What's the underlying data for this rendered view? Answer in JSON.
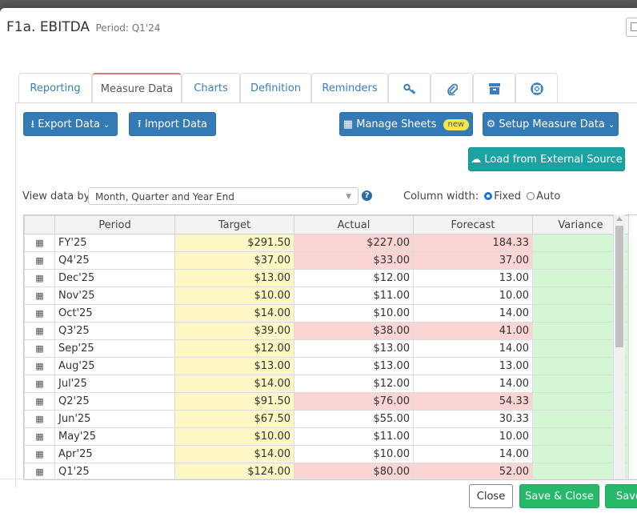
{
  "modal": {
    "title": "F1a. EBITDA",
    "period_label": "Period: Q1'24"
  },
  "tabs": [
    {
      "label": "Reporting",
      "active": false
    },
    {
      "label": "Measure Data",
      "active": true
    },
    {
      "label": "Charts",
      "active": false
    },
    {
      "label": "Definition",
      "active": false
    },
    {
      "label": "Reminders",
      "active": false
    },
    {
      "icon": "key-icon"
    },
    {
      "icon": "paperclip-icon"
    },
    {
      "icon": "archive-icon"
    },
    {
      "icon": "lifebuoy-icon"
    }
  ],
  "toolbar": {
    "export_label": "Export Data",
    "import_label": "Import Data",
    "manage_sheets_label": "Manage Sheets",
    "new_badge": "new",
    "setup_label": "Setup Measure Data",
    "load_external_label": "Load from External Source"
  },
  "view": {
    "view_by_label": "View data by:",
    "view_by_value": "Month, Quarter and Year End",
    "column_width_label": "Column width:",
    "fixed_label": "Fixed",
    "auto_label": "Auto",
    "selected_width": "Fixed"
  },
  "grid": {
    "columns": [
      "Period",
      "Target",
      "Actual",
      "Forecast",
      "Variance"
    ],
    "rows": [
      {
        "period": "FY'25",
        "target": "$291.50",
        "actual": "$227.00",
        "forecast": "184.33",
        "t": "yellow",
        "a": "red",
        "f": "red",
        "v": "green"
      },
      {
        "period": "Q4'25",
        "target": "$37.00",
        "actual": "$33.00",
        "forecast": "37.00",
        "t": "yellow",
        "a": "red",
        "f": "red",
        "v": "green"
      },
      {
        "period": "Dec'25",
        "target": "$13.00",
        "actual": "$12.00",
        "forecast": "13.00",
        "t": "yellow",
        "a": "white",
        "f": "white",
        "v": "green"
      },
      {
        "period": "Nov'25",
        "target": "$10.00",
        "actual": "$11.00",
        "forecast": "10.00",
        "t": "yellow",
        "a": "white",
        "f": "white",
        "v": "green"
      },
      {
        "period": "Oct'25",
        "target": "$14.00",
        "actual": "$10.00",
        "forecast": "14.00",
        "t": "yellow",
        "a": "white",
        "f": "white",
        "v": "green"
      },
      {
        "period": "Q3'25",
        "target": "$39.00",
        "actual": "$38.00",
        "forecast": "41.00",
        "t": "yellow",
        "a": "red",
        "f": "red",
        "v": "green"
      },
      {
        "period": "Sep'25",
        "target": "$12.00",
        "actual": "$13.00",
        "forecast": "14.00",
        "t": "yellow",
        "a": "white",
        "f": "white",
        "v": "green"
      },
      {
        "period": "Aug'25",
        "target": "$13.00",
        "actual": "$13.00",
        "forecast": "13.00",
        "t": "yellow",
        "a": "white",
        "f": "white",
        "v": "green"
      },
      {
        "period": "Jul'25",
        "target": "$14.00",
        "actual": "$12.00",
        "forecast": "14.00",
        "t": "yellow",
        "a": "white",
        "f": "white",
        "v": "green"
      },
      {
        "period": "Q2'25",
        "target": "$91.50",
        "actual": "$76.00",
        "forecast": "54.33",
        "t": "yellow",
        "a": "red",
        "f": "red",
        "v": "green"
      },
      {
        "period": "Jun'25",
        "target": "$67.50",
        "actual": "$55.00",
        "forecast": "30.33",
        "t": "yellow",
        "a": "white",
        "f": "white",
        "v": "green"
      },
      {
        "period": "May'25",
        "target": "$10.00",
        "actual": "$11.00",
        "forecast": "10.00",
        "t": "yellow",
        "a": "white",
        "f": "white",
        "v": "green"
      },
      {
        "period": "Apr'25",
        "target": "$14.00",
        "actual": "$10.00",
        "forecast": "14.00",
        "t": "yellow",
        "a": "white",
        "f": "white",
        "v": "green"
      },
      {
        "period": "Q1'25",
        "target": "$124.00",
        "actual": "$80.00",
        "forecast": "52.00",
        "t": "yellow",
        "a": "red",
        "f": "red",
        "v": "green"
      }
    ]
  },
  "footer": {
    "close_label": "Close",
    "save_close_label": "Save & Close",
    "save_label": "Save"
  },
  "colors": {
    "primary": "#337ab7",
    "teal": "#1ba3a3",
    "green": "#27b86a",
    "target_cell": "#fdf8c3",
    "miss_cell": "#fbd4d4",
    "variance_cell": "#d5f6d5"
  }
}
